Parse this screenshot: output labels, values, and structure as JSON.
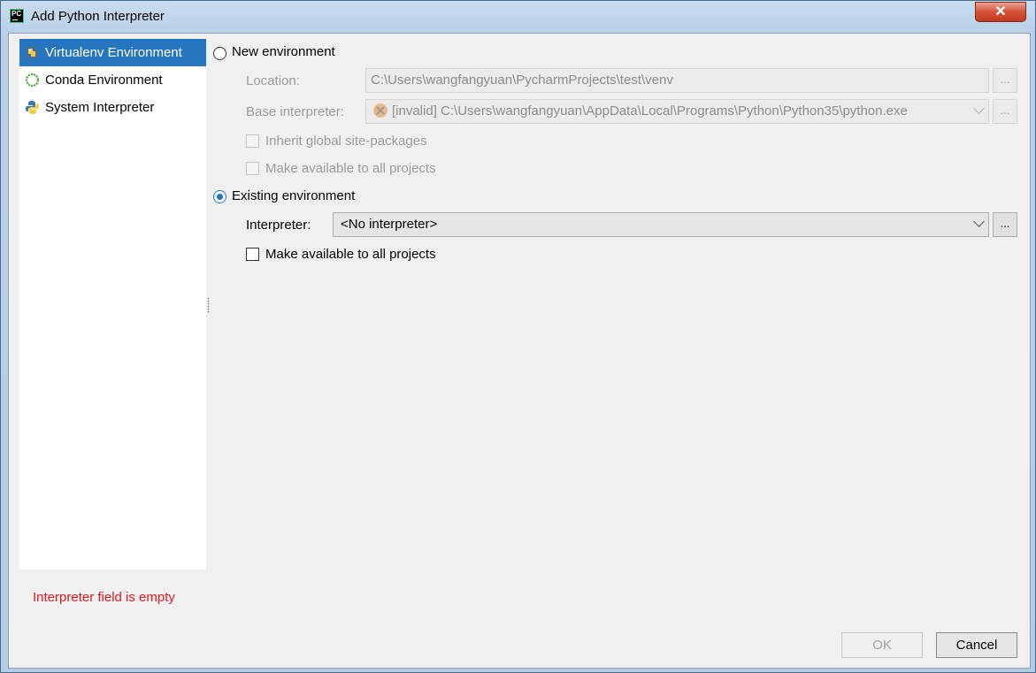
{
  "window": {
    "title": "Add Python Interpreter",
    "close_label": "✕",
    "app_icon_label": "PC"
  },
  "sidebar": {
    "items": [
      {
        "label": "Virtualenv Environment",
        "icon": "virtualenv-icon",
        "selected": true
      },
      {
        "label": "Conda Environment",
        "icon": "conda-icon",
        "selected": false
      },
      {
        "label": "System Interpreter",
        "icon": "python-icon",
        "selected": false
      }
    ]
  },
  "error": "Interpreter field is empty",
  "new_env": {
    "radio_label": "New environment",
    "location_label": "Location:",
    "location_value": "C:\\Users\\wangfangyuan\\PycharmProjects\\test\\venv",
    "base_label": "Base interpreter:",
    "base_value": "[invalid] C:\\Users\\wangfangyuan\\AppData\\Local\\Programs\\Python\\Python35\\python.exe",
    "inherit_label": "Inherit global site-packages",
    "make_available_label": "Make available to all projects",
    "browse": "..."
  },
  "existing_env": {
    "radio_label": "Existing environment",
    "interpreter_label": "Interpreter:",
    "interpreter_value": "<No interpreter>",
    "make_available_label": "Make available to all projects",
    "browse": "..."
  },
  "buttons": {
    "ok": "OK",
    "cancel": "Cancel"
  },
  "colors": {
    "selection": "#2675bf",
    "error": "#e0191d"
  }
}
